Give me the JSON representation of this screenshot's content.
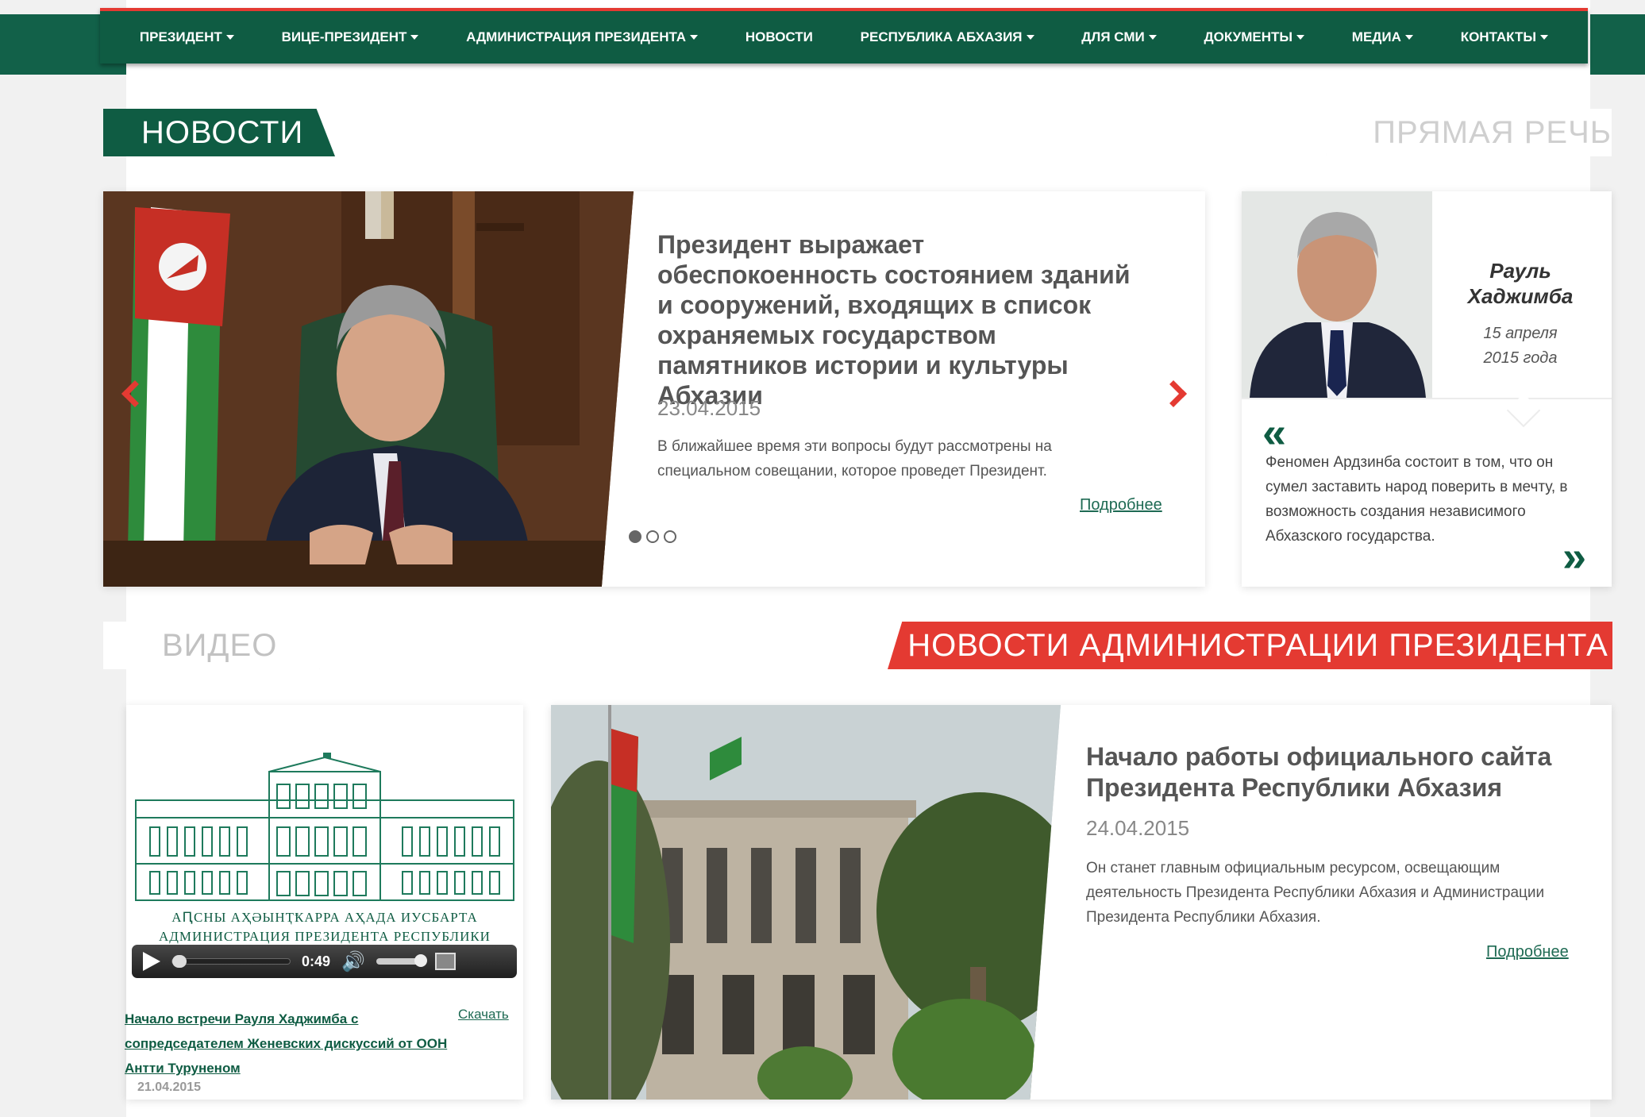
{
  "nav": {
    "items": [
      {
        "label": "ПРЕЗИДЕНТ",
        "dropdown": true
      },
      {
        "label": "ВИЦЕ-ПРЕЗИДЕНТ",
        "dropdown": true
      },
      {
        "label": "АДМИНИСТРАЦИЯ ПРЕЗИДЕНТА",
        "dropdown": true
      },
      {
        "label": "НОВОСТИ",
        "dropdown": false
      },
      {
        "label": "РЕСПУБЛИКА АБХАЗИЯ",
        "dropdown": true
      },
      {
        "label": "ДЛЯ СМИ",
        "dropdown": true
      },
      {
        "label": "ДОКУМЕНТЫ",
        "dropdown": true
      },
      {
        "label": "МЕДИА",
        "dropdown": true
      },
      {
        "label": "КОНТАКТЫ",
        "dropdown": true
      }
    ]
  },
  "sections": {
    "news": "НОВОСТИ",
    "speech": "ПРЯМАЯ РЕЧЬ",
    "video": "ВИДЕО",
    "admin_news": "НОВОСТИ АДМИНИСТРАЦИИ ПРЕЗИДЕНТА"
  },
  "slider": {
    "title": "Президент выражает обеспокоенность состоянием зданий и сооружений, входящих в список охраняемых государством памятников истории и культуры Абхазии",
    "date": "23.04.2015",
    "description": "В ближайшее время эти вопросы будут рассмотрены на специальном совещании, которое проведет Президент.",
    "more": "Подробнее",
    "total_slides": 3,
    "active_slide": 1
  },
  "speech": {
    "name_first": "Рауль",
    "name_last": "Хаджимба",
    "date_line1": "15 апреля",
    "date_line2": "2015 года",
    "quote": "Феномен Ардзинба состоит в том, что он сумел заставить народ поверить в мечту, в возможность создания независимого Абхазского государства."
  },
  "video": {
    "caption1": "АԤСНЫ АҲӘЫНҬҞАРРА АҲАДА ИУСБАРТА",
    "caption2": "АДМИНИСТРАЦИЯ ПРЕЗИДЕНТА РЕСПУБЛИКИ АБХАЗИЯ",
    "time": "0:49",
    "title": "Начало встречи Рауля Хаджимба с сопредседателем Женевских дискуссий от ООН Антти Туруненом",
    "download": "Скачать",
    "date": "21.04.2015"
  },
  "admin_news": {
    "title": "Начало работы официального сайта Президента Республики Абхазия",
    "date": "24.04.2015",
    "description": "Он станет главным официальным ресурсом, освещающим деятельность Президента Республики Абхазия и Администрации Президента Республики Абхазия.",
    "more": "Подробнее"
  },
  "colors": {
    "brand_green": "#0f5c43",
    "accent_red": "#e43a32"
  }
}
